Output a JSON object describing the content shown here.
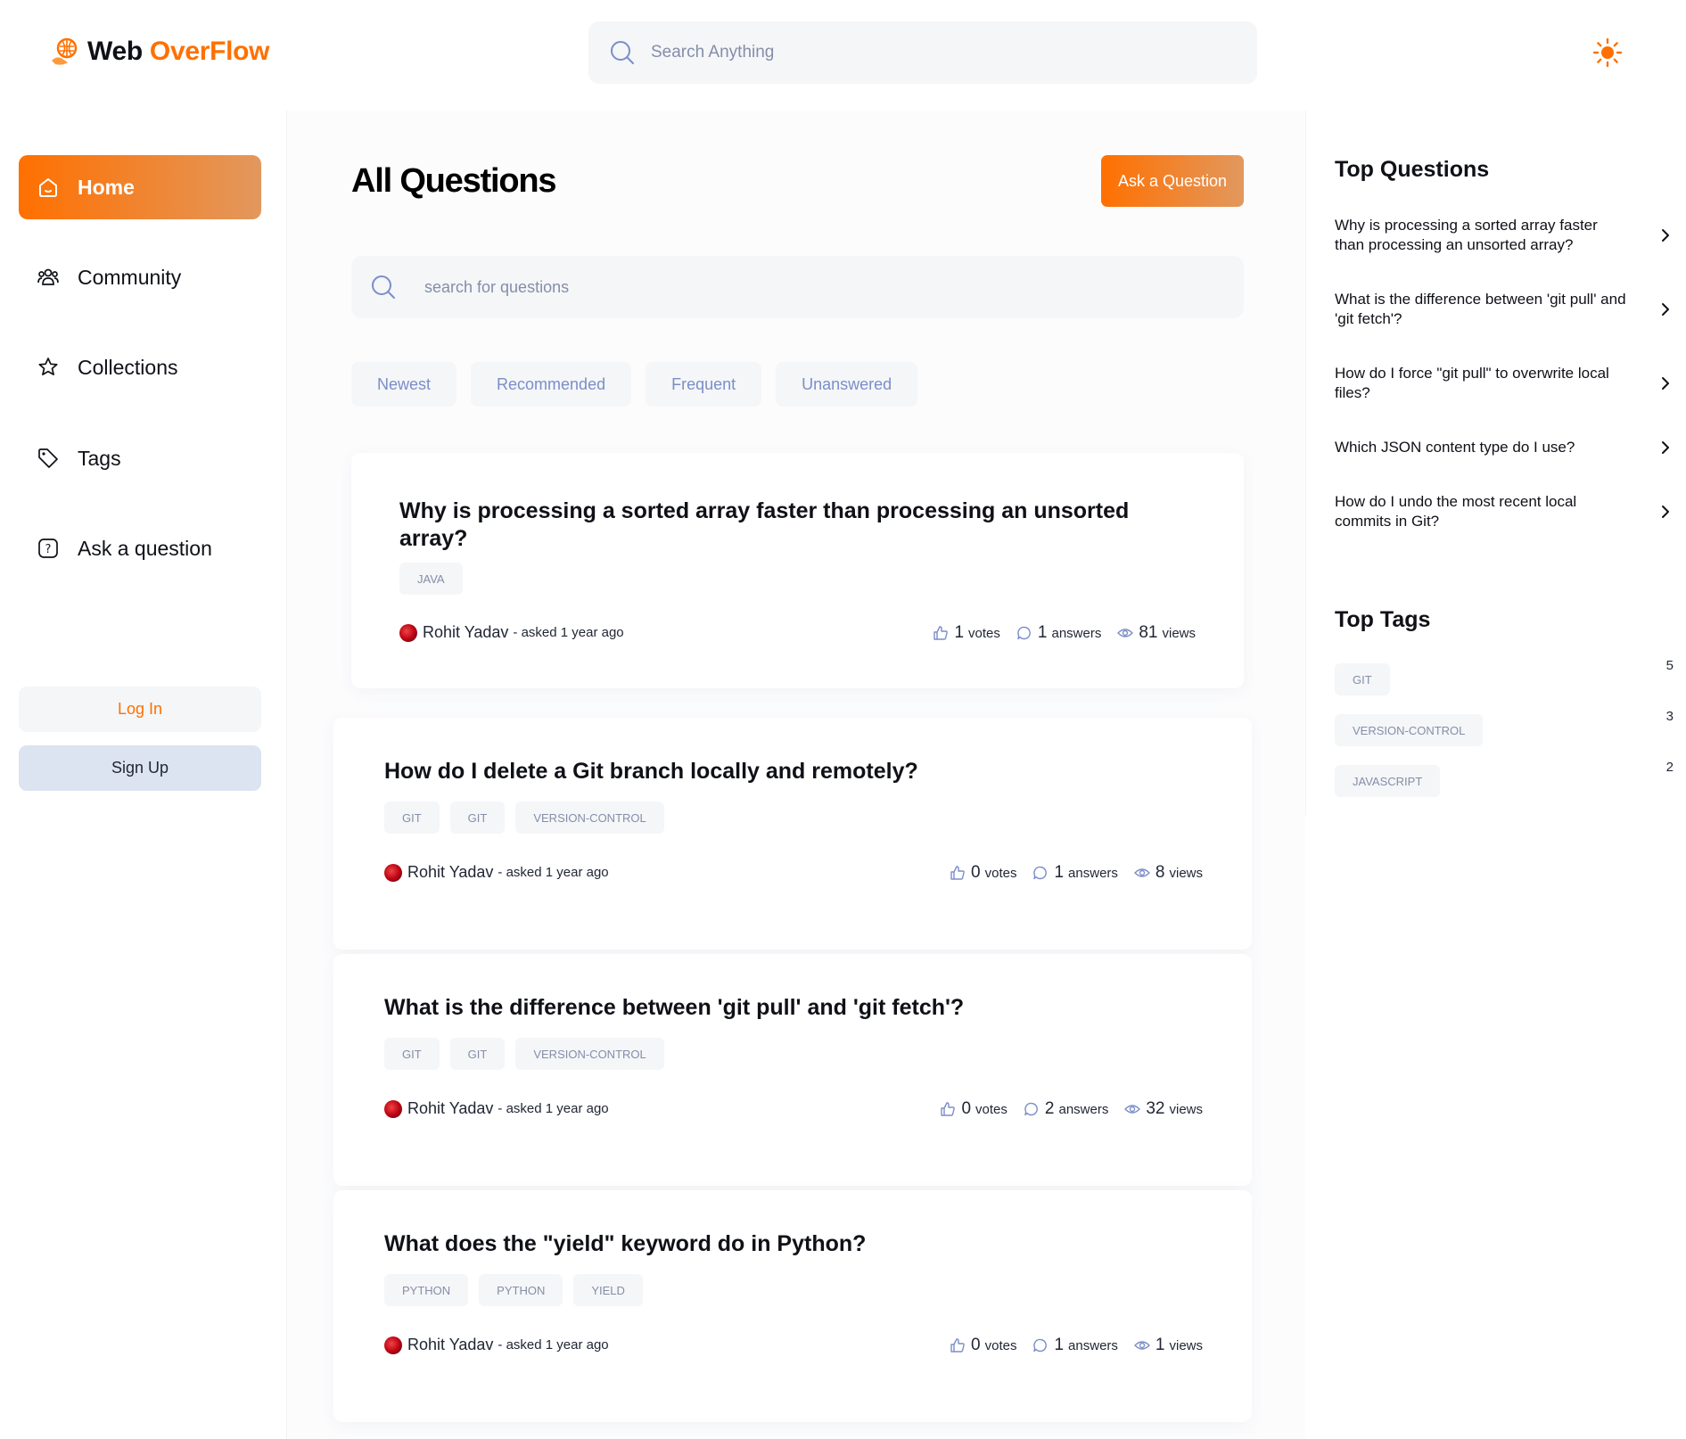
{
  "header": {
    "brand_main": "Web ",
    "brand_accent": "OverFlow",
    "search_placeholder": "Search Anything",
    "accent_color": "#ff7000"
  },
  "sidebar": {
    "items": [
      {
        "label": "Home",
        "icon": "home-icon",
        "active": true
      },
      {
        "label": "Community",
        "icon": "users-icon"
      },
      {
        "label": "Collections",
        "icon": "star-icon"
      },
      {
        "label": "Tags",
        "icon": "tag-icon"
      },
      {
        "label": "Ask a question",
        "icon": "question-icon"
      }
    ],
    "login_label": "Log In",
    "signup_label": "Sign Up"
  },
  "main": {
    "title": "All Questions",
    "ask_button": "Ask a Question",
    "search_placeholder": "search for questions",
    "filters": [
      "Newest",
      "Recommended",
      "Frequent",
      "Unanswered"
    ],
    "questions": [
      {
        "title": "Why is processing a sorted array faster than processing an unsorted array?",
        "tags": [
          "JAVA"
        ],
        "author": "Rohit Yadav",
        "asked": "- asked 1 year ago",
        "votes": "1",
        "votes_label": "votes",
        "answers": "1",
        "answers_label": "answers",
        "views": "81",
        "views_label": "views"
      },
      {
        "title": "How do I delete a Git branch locally and remotely?",
        "tags": [
          "GIT",
          "GIT",
          "VERSION-CONTROL"
        ],
        "author": "Rohit Yadav",
        "asked": "- asked 1 year ago",
        "votes": "0",
        "votes_label": "votes",
        "answers": "1",
        "answers_label": "answers",
        "views": "8",
        "views_label": "views"
      },
      {
        "title": "What is the difference between 'git pull' and 'git fetch'?",
        "tags": [
          "GIT",
          "GIT",
          "VERSION-CONTROL"
        ],
        "author": "Rohit Yadav",
        "asked": "- asked 1 year ago",
        "votes": "0",
        "votes_label": "votes",
        "answers": "2",
        "answers_label": "answers",
        "views": "32",
        "views_label": "views"
      },
      {
        "title": "What does the \"yield\" keyword do in Python?",
        "tags": [
          "PYTHON",
          "PYTHON",
          "YIELD"
        ],
        "author": "Rohit Yadav",
        "asked": "- asked 1 year ago",
        "votes": "0",
        "votes_label": "votes",
        "answers": "1",
        "answers_label": "answers",
        "views": "1",
        "views_label": "views"
      }
    ]
  },
  "rightbar": {
    "top_questions_heading": "Top Questions",
    "top_questions": [
      "Why is processing a sorted array faster than processing an unsorted array?",
      "What is the difference between 'git pull' and 'git fetch'?",
      "How do I force \"git pull\" to overwrite local files?",
      "Which JSON content type do I use?",
      "How do I undo the most recent local commits in Git?"
    ],
    "top_tags_heading": "Top Tags",
    "top_tags": [
      {
        "name": "GIT",
        "count": "5"
      },
      {
        "name": "VERSION-CONTROL",
        "count": "3"
      },
      {
        "name": "JAVASCRIPT",
        "count": "2"
      }
    ]
  }
}
